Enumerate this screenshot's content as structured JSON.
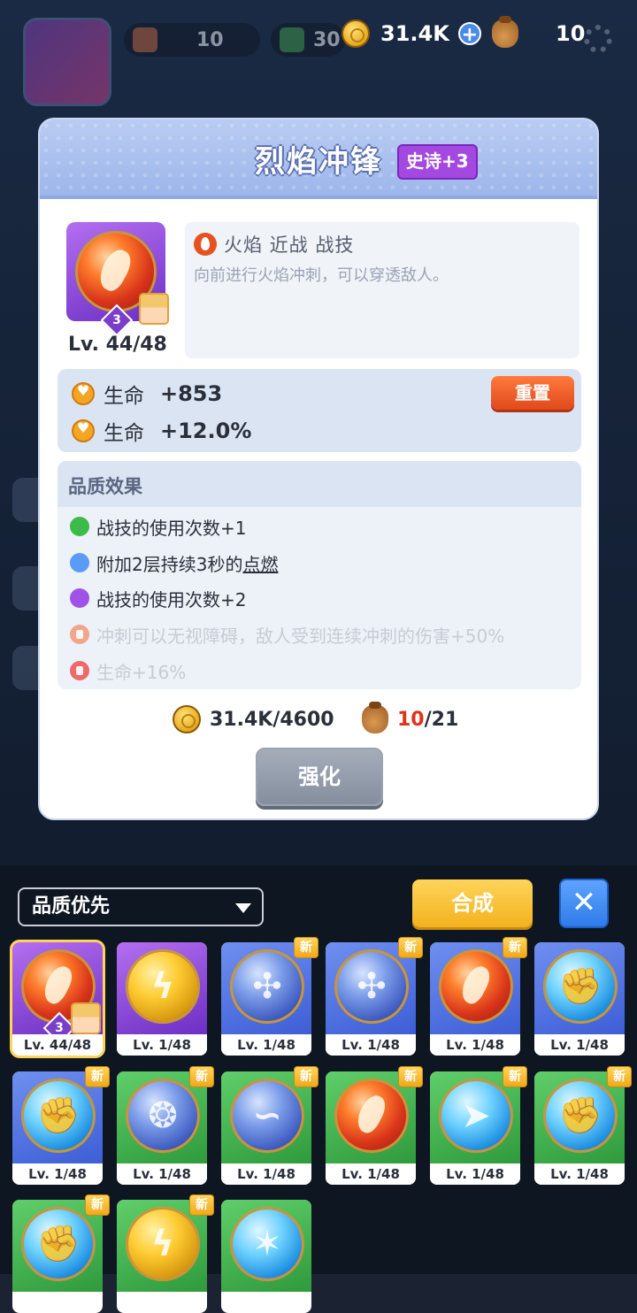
{
  "topbar": {
    "resources": [
      {
        "name": "cake",
        "value": "10"
      },
      {
        "name": "gem",
        "value": "30"
      }
    ],
    "coins": "31.4K",
    "bags": "10"
  },
  "card": {
    "title": "烈焰冲锋",
    "rarity": "史诗+3",
    "skill_level_badge": "3",
    "level": "Lv. 44/48",
    "tags": "火焰 近战 战技",
    "description": "向前进行火焰冲刺，可以穿透敌人。",
    "stats": [
      {
        "name": "生命",
        "value": "+853"
      },
      {
        "name": "生命",
        "value": "+12.0%"
      }
    ],
    "reset_label": "重置",
    "quality_title": "品质效果",
    "quality_effects": [
      {
        "text": "战技的使用次数+1",
        "color": "#3dbb4a",
        "locked": false
      },
      {
        "text_before": "附加2层持续3秒的",
        "text_link": "点燃",
        "color": "#5a9cf5",
        "locked": false
      },
      {
        "text": "战技的使用次数+2",
        "color": "#a052e6",
        "locked": false
      },
      {
        "text": "冲刺可以无视障碍，敌人受到连续冲刺的伤害+50%",
        "color": "#f2a58a",
        "locked": true
      },
      {
        "text": "生命+16%",
        "color": "#ee6a6a",
        "locked": true
      }
    ],
    "cost_coins": "31.4K",
    "cost_coins_need": "/4600",
    "cost_bags_have": "10",
    "cost_bags_need": "/21",
    "strengthen_label": "强化"
  },
  "inventory": {
    "sort_label": "品质优先",
    "combine_label": "合成",
    "close_label": "✕",
    "new_label": "新",
    "items": [
      {
        "level": "Lv. 44/48",
        "bg": "sel",
        "orb": "fire",
        "glyph": "",
        "new": false,
        "selected": true,
        "badge": "3"
      },
      {
        "level": "Lv. 1/48",
        "bg": "purple",
        "orb": "gold",
        "glyph": "ϟ",
        "new": false
      },
      {
        "level": "Lv. 1/48",
        "bg": "blue",
        "orb": "wind",
        "glyph": "✣",
        "new": true
      },
      {
        "level": "Lv. 1/48",
        "bg": "blue",
        "orb": "wind",
        "glyph": "✣",
        "new": true
      },
      {
        "level": "Lv. 1/48",
        "bg": "blue",
        "orb": "fire",
        "glyph": "",
        "new": true
      },
      {
        "level": "Lv. 1/48",
        "bg": "blue",
        "orb": "ice",
        "glyph": "✊",
        "new": false
      },
      {
        "level": "Lv. 1/48",
        "bg": "blue",
        "orb": "ice",
        "glyph": "✊",
        "new": true
      },
      {
        "level": "Lv. 1/48",
        "bg": "green",
        "orb": "wind",
        "glyph": "❂",
        "new": true
      },
      {
        "level": "Lv. 1/48",
        "bg": "green",
        "orb": "wind",
        "glyph": "∽",
        "new": true
      },
      {
        "level": "Lv. 1/48",
        "bg": "green",
        "orb": "fire",
        "glyph": "",
        "new": true
      },
      {
        "level": "Lv. 1/48",
        "bg": "green",
        "orb": "ice",
        "glyph": "➤",
        "new": true
      },
      {
        "level": "Lv. 1/48",
        "bg": "green",
        "orb": "ice",
        "glyph": "✊",
        "new": true
      },
      {
        "level": "",
        "bg": "green",
        "orb": "ice",
        "glyph": "✊",
        "new": true
      },
      {
        "level": "",
        "bg": "green",
        "orb": "gold",
        "glyph": "ϟ",
        "new": true
      },
      {
        "level": "",
        "bg": "green",
        "orb": "ice",
        "glyph": "✶",
        "new": false
      }
    ]
  }
}
